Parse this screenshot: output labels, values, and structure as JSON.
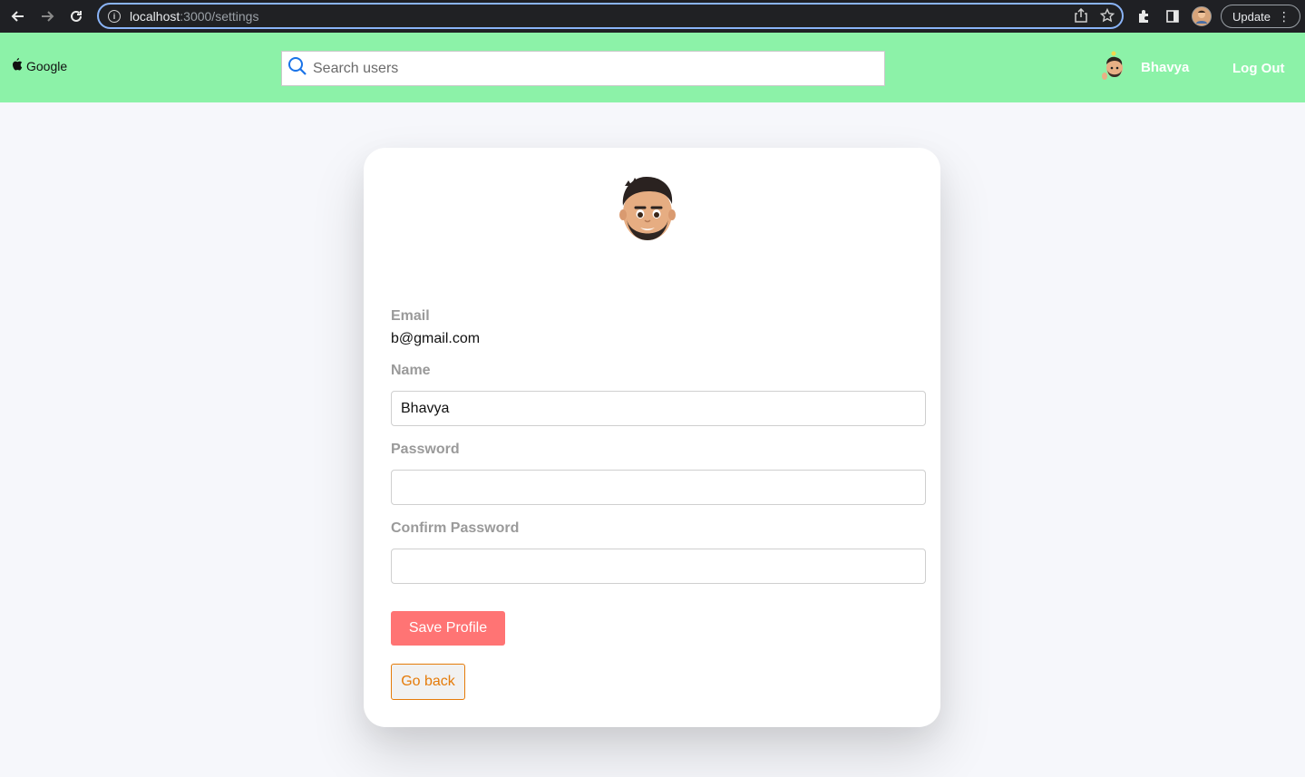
{
  "browser": {
    "url_host": "localhost",
    "url_path": ":3000/settings",
    "update_label": "Update",
    "icons": [
      "back-icon",
      "forward-icon",
      "reload-icon",
      "info-icon",
      "share-icon",
      "star-icon",
      "extensions-icon",
      "sidepanel-icon",
      "profile-icon",
      "more-icon"
    ]
  },
  "header": {
    "logo_text": "Google",
    "search_placeholder": "Search users",
    "user_name": "Bhavya",
    "logout_label": "Log Out",
    "background": "#8cf2a8"
  },
  "profile": {
    "email_label": "Email",
    "email_value": "b@gmail.com",
    "name_label": "Name",
    "name_value": "Bhavya",
    "password_label": "Password",
    "password_value": "",
    "confirm_password_label": "Confirm Password",
    "confirm_password_value": "",
    "save_label": "Save Profile",
    "back_label": "Go back",
    "save_color": "#ff7474",
    "back_color": "#e57b09"
  }
}
